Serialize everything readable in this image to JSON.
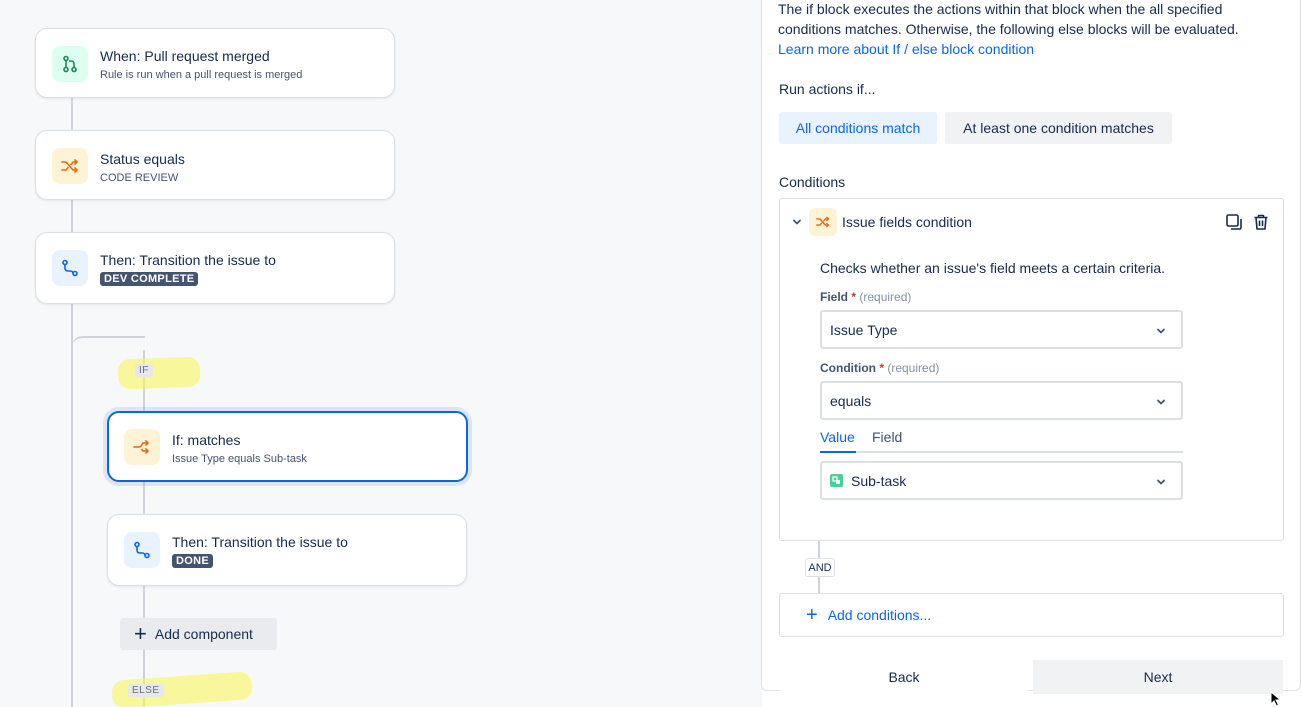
{
  "canvas": {
    "rule_nodes": [
      {
        "title": "When: Pull request merged",
        "subtitle": "Rule is run when a pull request is merged",
        "icon": "git-branch-icon"
      },
      {
        "title": "Status equals",
        "subtitle": "CODE REVIEW",
        "icon": "shuffle-icon"
      },
      {
        "title": "Then: Transition the issue to",
        "lozenge": "DEV COMPLETE",
        "icon": "transition-icon"
      }
    ],
    "if_label": "IF",
    "if_node": {
      "title": "If: matches",
      "subtitle": "Issue Type equals Sub-task",
      "icon": "shuffle-icon"
    },
    "then_node": {
      "title": "Then: Transition the issue to",
      "lozenge": "DONE",
      "icon": "transition-icon"
    },
    "add_component": "Add component",
    "else_label": "ELSE"
  },
  "panel": {
    "description": "The if block executes the actions within that block when the all specified conditions matches. Otherwise, the following else blocks will be evaluated.",
    "learn_more": "Learn more about If / else block condition",
    "run_actions_label": "Run actions if...",
    "match_options": [
      "All conditions match",
      "At least one condition matches"
    ],
    "conditions_label": "Conditions",
    "condition": {
      "title": "Issue fields condition",
      "description": "Checks whether an issue's field meets a certain criteria.",
      "field_label": "Field",
      "field_required": "(required)",
      "field_value": "Issue Type",
      "condition_label": "Condition",
      "condition_required": "(required)",
      "condition_value": "equals",
      "tabs": [
        "Value",
        "Field"
      ],
      "value": "Sub-task"
    },
    "and_label": "AND",
    "add_conditions": "Add conditions...",
    "back": "Back",
    "next": "Next"
  },
  "colors": {
    "accent": "#0c66e4",
    "icon_green_bg": "#dcfff1",
    "icon_orange_bg": "#fff3d6",
    "icon_blue_bg": "#e9f2ff",
    "highlight": "#faf550"
  }
}
